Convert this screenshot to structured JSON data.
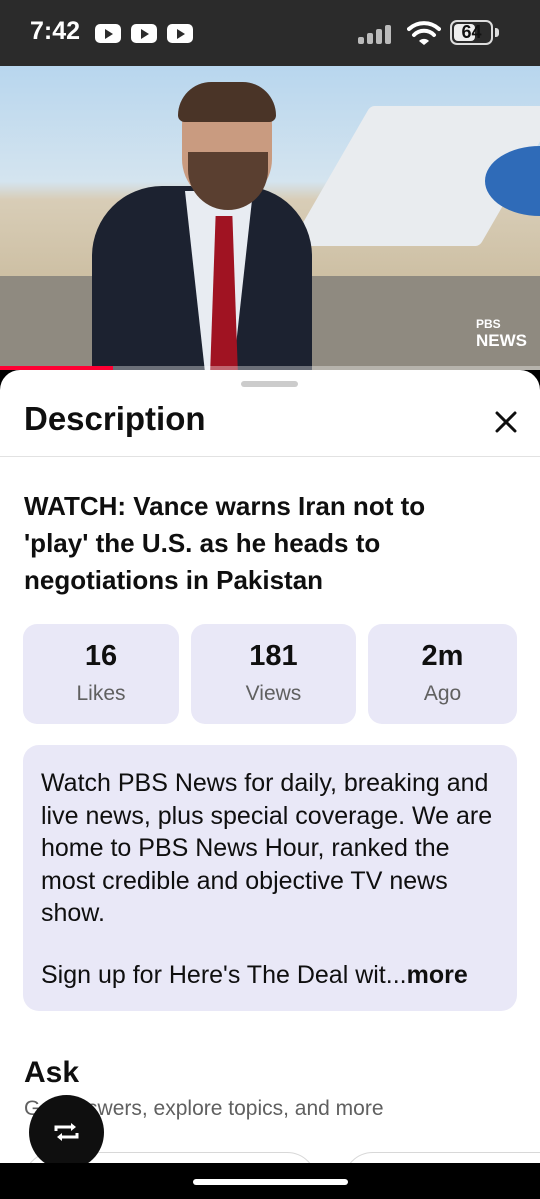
{
  "status_bar": {
    "time": "7:42",
    "battery": "64",
    "battery_level": 0.64,
    "notification_icons": [
      "youtube-icon",
      "youtube-icon",
      "youtube-icon"
    ]
  },
  "video": {
    "logo_top": "PBS",
    "logo_bottom": "NEWS",
    "progress": 0.21,
    "progress_color": "#ff0033"
  },
  "sheet": {
    "title": "Description",
    "close_icon": "close-icon",
    "video_title": "WATCH: Vance warns Iran not to 'play' the U.S. as he heads to negotiations in Pakistan",
    "stats": [
      {
        "value": "16",
        "label": "Likes"
      },
      {
        "value": "181",
        "label": "Views"
      },
      {
        "value": "2m",
        "label": "Ago"
      }
    ],
    "description": {
      "text": "Watch PBS News for daily, breaking and live news, plus special coverage. We are home to PBS News Hour, ranked the most credible and objective TV news show.",
      "last_line": "Sign up for Here's The Deal wit...",
      "more_label": "more"
    },
    "ask": {
      "title": "Ask",
      "subtitle": "Get answers, explore topics, and more"
    }
  },
  "fab": {
    "icon": "repeat-icon"
  },
  "colors": {
    "card_background": "#e9e8f7",
    "text_primary": "#0f0f0f",
    "text_secondary": "#606060"
  }
}
